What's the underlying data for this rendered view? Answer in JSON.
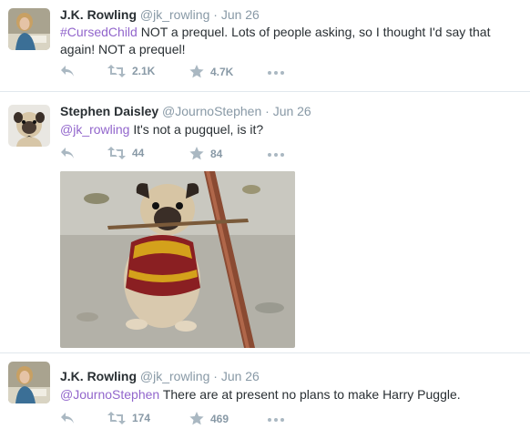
{
  "tweets": [
    {
      "name": "J.K. Rowling",
      "handle": "@jk_rowling",
      "separator": "·",
      "time": "Jun 26",
      "text_link": "#CursedChild",
      "text_rest": " NOT a prequel. Lots of people asking, so I thought I'd say that again! NOT a prequel!",
      "retweets": "2.1K",
      "likes": "4.7K"
    },
    {
      "name": "Stephen Daisley",
      "handle": "@JournoStephen",
      "separator": "·",
      "time": "Jun 26",
      "text_link": "@jk_rowling",
      "text_rest": " It's not a pugquel, is it?",
      "retweets": "44",
      "likes": "84"
    },
    {
      "name": "J.K. Rowling",
      "handle": "@jk_rowling",
      "separator": "·",
      "time": "Jun 26",
      "text_link": "@JournoStephen",
      "text_rest": " There are at present no plans to make Harry Puggle.",
      "retweets": "174",
      "likes": "469"
    }
  ],
  "icons": {
    "reply": "reply-icon",
    "retweet": "retweet-icon",
    "like": "star-icon",
    "more": "more-icon"
  },
  "colors": {
    "link": "#9266cc",
    "muted": "#8899a6",
    "icon": "#aab8c2",
    "divider": "#e1e8ed"
  }
}
